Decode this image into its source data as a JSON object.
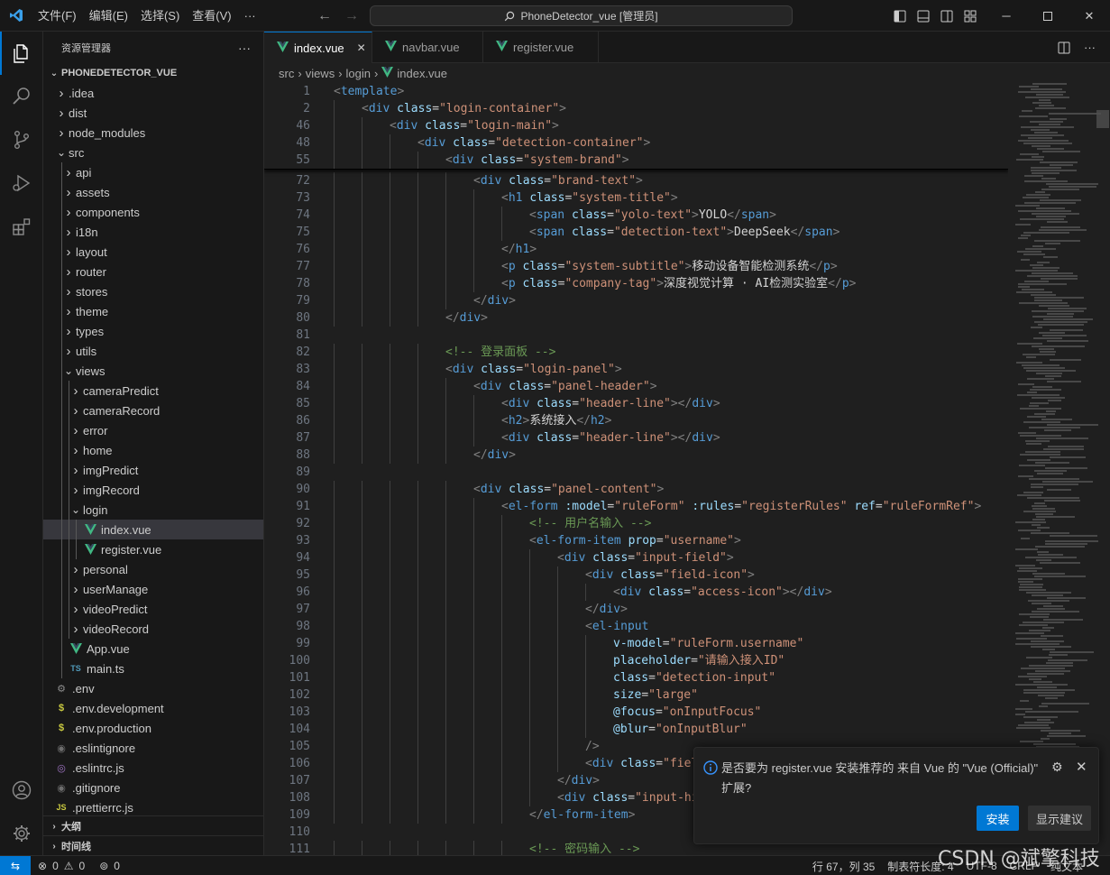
{
  "titlebar": {
    "menu": [
      "文件(F)",
      "编辑(E)",
      "选择(S)",
      "查看(V)",
      "···"
    ],
    "search_text": "PhoneDetector_vue [管理员]"
  },
  "sidebar": {
    "title": "资源管理器",
    "more": "···",
    "root": "PHONEDETECTOR_VUE",
    "items": [
      {
        "label": ".idea",
        "depth": 1,
        "type": "folder",
        "open": false
      },
      {
        "label": "dist",
        "depth": 1,
        "type": "folder",
        "open": false
      },
      {
        "label": "node_modules",
        "depth": 1,
        "type": "folder",
        "open": false
      },
      {
        "label": "src",
        "depth": 1,
        "type": "folder",
        "open": true
      },
      {
        "label": "api",
        "depth": 2,
        "type": "folder",
        "open": false
      },
      {
        "label": "assets",
        "depth": 2,
        "type": "folder",
        "open": false
      },
      {
        "label": "components",
        "depth": 2,
        "type": "folder",
        "open": false
      },
      {
        "label": "i18n",
        "depth": 2,
        "type": "folder",
        "open": false
      },
      {
        "label": "layout",
        "depth": 2,
        "type": "folder",
        "open": false
      },
      {
        "label": "router",
        "depth": 2,
        "type": "folder",
        "open": false
      },
      {
        "label": "stores",
        "depth": 2,
        "type": "folder",
        "open": false
      },
      {
        "label": "theme",
        "depth": 2,
        "type": "folder",
        "open": false
      },
      {
        "label": "types",
        "depth": 2,
        "type": "folder",
        "open": false
      },
      {
        "label": "utils",
        "depth": 2,
        "type": "folder",
        "open": false
      },
      {
        "label": "views",
        "depth": 2,
        "type": "folder",
        "open": true
      },
      {
        "label": "cameraPredict",
        "depth": 3,
        "type": "folder",
        "open": false
      },
      {
        "label": "cameraRecord",
        "depth": 3,
        "type": "folder",
        "open": false
      },
      {
        "label": "error",
        "depth": 3,
        "type": "folder",
        "open": false
      },
      {
        "label": "home",
        "depth": 3,
        "type": "folder",
        "open": false
      },
      {
        "label": "imgPredict",
        "depth": 3,
        "type": "folder",
        "open": false
      },
      {
        "label": "imgRecord",
        "depth": 3,
        "type": "folder",
        "open": false
      },
      {
        "label": "login",
        "depth": 3,
        "type": "folder",
        "open": true
      },
      {
        "label": "index.vue",
        "depth": 4,
        "type": "vue",
        "selected": true
      },
      {
        "label": "register.vue",
        "depth": 4,
        "type": "vue"
      },
      {
        "label": "personal",
        "depth": 3,
        "type": "folder",
        "open": false
      },
      {
        "label": "userManage",
        "depth": 3,
        "type": "folder",
        "open": false
      },
      {
        "label": "videoPredict",
        "depth": 3,
        "type": "folder",
        "open": false
      },
      {
        "label": "videoRecord",
        "depth": 3,
        "type": "folder",
        "open": false
      },
      {
        "label": "App.vue",
        "depth": 2,
        "type": "vue"
      },
      {
        "label": "main.ts",
        "depth": 2,
        "type": "ts"
      },
      {
        "label": ".env",
        "depth": 1,
        "type": "gear"
      },
      {
        "label": ".env.development",
        "depth": 1,
        "type": "dollar"
      },
      {
        "label": ".env.production",
        "depth": 1,
        "type": "dollar"
      },
      {
        "label": ".eslintignore",
        "depth": 1,
        "type": "circle"
      },
      {
        "label": ".eslintrc.js",
        "depth": 1,
        "type": "eslint"
      },
      {
        "label": ".gitignore",
        "depth": 1,
        "type": "circle"
      },
      {
        "label": ".prettierrc.js",
        "depth": 1,
        "type": "js"
      }
    ],
    "outline": "大纲",
    "timeline": "时间线"
  },
  "tabs": [
    {
      "label": "index.vue",
      "active": true,
      "close": "✕"
    },
    {
      "label": "navbar.vue",
      "active": false
    },
    {
      "label": "register.vue",
      "active": false
    }
  ],
  "breadcrumb": [
    "src",
    "views",
    "login",
    "index.vue"
  ],
  "sticky": [
    {
      "n": "1",
      "indent": 0,
      "html": "<span class='c-punc'>&lt;</span><span class='c-tag'>template</span><span class='c-punc'>&gt;</span>"
    },
    {
      "n": "2",
      "indent": 1,
      "html": "<span class='c-punc'>&lt;</span><span class='c-tag'>div</span> <span class='c-attr'>class</span>=<span class='c-str'>\"login-container\"</span><span class='c-punc'>&gt;</span>"
    },
    {
      "n": "46",
      "indent": 2,
      "html": "<span class='c-punc'>&lt;</span><span class='c-tag'>div</span> <span class='c-attr'>class</span>=<span class='c-str'>\"login-main\"</span><span class='c-punc'>&gt;</span>"
    },
    {
      "n": "48",
      "indent": 3,
      "html": "<span class='c-punc'>&lt;</span><span class='c-tag'>div</span> <span class='c-attr'>class</span>=<span class='c-str'>\"detection-container\"</span><span class='c-punc'>&gt;</span>"
    },
    {
      "n": "55",
      "indent": 4,
      "html": "<span class='c-punc'>&lt;</span><span class='c-tag'>div</span> <span class='c-attr'>class</span>=<span class='c-str'>\"system-brand\"</span><span class='c-punc'>&gt;</span>"
    }
  ],
  "code": [
    {
      "n": "72",
      "indent": 5,
      "html": "<span class='c-punc'>&lt;</span><span class='c-tag'>div</span> <span class='c-attr'>class</span>=<span class='c-str'>\"brand-text\"</span><span class='c-punc'>&gt;</span>"
    },
    {
      "n": "73",
      "indent": 6,
      "html": "<span class='c-punc'>&lt;</span><span class='c-tag'>h1</span> <span class='c-attr'>class</span>=<span class='c-str'>\"system-title\"</span><span class='c-punc'>&gt;</span>"
    },
    {
      "n": "74",
      "indent": 7,
      "html": "<span class='c-punc'>&lt;</span><span class='c-tag'>span</span> <span class='c-attr'>class</span>=<span class='c-str'>\"yolo-text\"</span><span class='c-punc'>&gt;</span><span class='c-txt'>YOLO</span><span class='c-punc'>&lt;/</span><span class='c-tag'>span</span><span class='c-punc'>&gt;</span>"
    },
    {
      "n": "75",
      "indent": 7,
      "html": "<span class='c-punc'>&lt;</span><span class='c-tag'>span</span> <span class='c-attr'>class</span>=<span class='c-str'>\"detection-text\"</span><span class='c-punc'>&gt;</span><span class='c-txt'>DeepSeek</span><span class='c-punc'>&lt;/</span><span class='c-tag'>span</span><span class='c-punc'>&gt;</span>"
    },
    {
      "n": "76",
      "indent": 6,
      "html": "<span class='c-punc'>&lt;/</span><span class='c-tag'>h1</span><span class='c-punc'>&gt;</span>"
    },
    {
      "n": "77",
      "indent": 6,
      "html": "<span class='c-punc'>&lt;</span><span class='c-tag'>p</span> <span class='c-attr'>class</span>=<span class='c-str'>\"system-subtitle\"</span><span class='c-punc'>&gt;</span><span class='c-txt'>移动设备智能检测系统</span><span class='c-punc'>&lt;/</span><span class='c-tag'>p</span><span class='c-punc'>&gt;</span>"
    },
    {
      "n": "78",
      "indent": 6,
      "html": "<span class='c-punc'>&lt;</span><span class='c-tag'>p</span> <span class='c-attr'>class</span>=<span class='c-str'>\"company-tag\"</span><span class='c-punc'>&gt;</span><span class='c-txt'>深度视觉计算 · AI检测实验室</span><span class='c-punc'>&lt;/</span><span class='c-tag'>p</span><span class='c-punc'>&gt;</span>"
    },
    {
      "n": "79",
      "indent": 5,
      "html": "<span class='c-punc'>&lt;/</span><span class='c-tag'>div</span><span class='c-punc'>&gt;</span>"
    },
    {
      "n": "80",
      "indent": 4,
      "html": "<span class='c-punc'>&lt;/</span><span class='c-tag'>div</span><span class='c-punc'>&gt;</span>"
    },
    {
      "n": "81",
      "indent": 0,
      "html": ""
    },
    {
      "n": "82",
      "indent": 4,
      "html": "<span class='c-comment'>&lt;!-- 登录面板 --&gt;</span>"
    },
    {
      "n": "83",
      "indent": 4,
      "html": "<span class='c-punc'>&lt;</span><span class='c-tag'>div</span> <span class='c-attr'>class</span>=<span class='c-str'>\"login-panel\"</span><span class='c-punc'>&gt;</span>"
    },
    {
      "n": "84",
      "indent": 5,
      "html": "<span class='c-punc'>&lt;</span><span class='c-tag'>div</span> <span class='c-attr'>class</span>=<span class='c-str'>\"panel-header\"</span><span class='c-punc'>&gt;</span>"
    },
    {
      "n": "85",
      "indent": 6,
      "html": "<span class='c-punc'>&lt;</span><span class='c-tag'>div</span> <span class='c-attr'>class</span>=<span class='c-str'>\"header-line\"</span><span class='c-punc'>&gt;&lt;/</span><span class='c-tag'>div</span><span class='c-punc'>&gt;</span>"
    },
    {
      "n": "86",
      "indent": 6,
      "html": "<span class='c-punc'>&lt;</span><span class='c-tag'>h2</span><span class='c-punc'>&gt;</span><span class='c-txt'>系统接入</span><span class='c-punc'>&lt;/</span><span class='c-tag'>h2</span><span class='c-punc'>&gt;</span>"
    },
    {
      "n": "87",
      "indent": 6,
      "html": "<span class='c-punc'>&lt;</span><span class='c-tag'>div</span> <span class='c-attr'>class</span>=<span class='c-str'>\"header-line\"</span><span class='c-punc'>&gt;&lt;/</span><span class='c-tag'>div</span><span class='c-punc'>&gt;</span>"
    },
    {
      "n": "88",
      "indent": 5,
      "html": "<span class='c-punc'>&lt;/</span><span class='c-tag'>div</span><span class='c-punc'>&gt;</span>"
    },
    {
      "n": "89",
      "indent": 0,
      "html": ""
    },
    {
      "n": "90",
      "indent": 5,
      "html": "<span class='c-punc'>&lt;</span><span class='c-tag'>div</span> <span class='c-attr'>class</span>=<span class='c-str'>\"panel-content\"</span><span class='c-punc'>&gt;</span>"
    },
    {
      "n": "91",
      "indent": 6,
      "html": "<span class='c-punc'>&lt;</span><span class='c-tag'>el-form</span> <span class='c-attr'>:model</span>=<span class='c-str'>\"ruleForm\"</span> <span class='c-attr'>:rules</span>=<span class='c-str'>\"registerRules\"</span> <span class='c-attr'>ref</span>=<span class='c-str'>\"ruleFormRef\"</span><span class='c-punc'>&gt;</span>"
    },
    {
      "n": "92",
      "indent": 7,
      "html": "<span class='c-comment'>&lt;!-- 用户名输入 --&gt;</span>"
    },
    {
      "n": "93",
      "indent": 7,
      "html": "<span class='c-punc'>&lt;</span><span class='c-tag'>el-form-item</span> <span class='c-attr'>prop</span>=<span class='c-str'>\"username\"</span><span class='c-punc'>&gt;</span>"
    },
    {
      "n": "94",
      "indent": 8,
      "html": "<span class='c-punc'>&lt;</span><span class='c-tag'>div</span> <span class='c-attr'>class</span>=<span class='c-str'>\"input-field\"</span><span class='c-punc'>&gt;</span>"
    },
    {
      "n": "95",
      "indent": 9,
      "html": "<span class='c-punc'>&lt;</span><span class='c-tag'>div</span> <span class='c-attr'>class</span>=<span class='c-str'>\"field-icon\"</span><span class='c-punc'>&gt;</span>"
    },
    {
      "n": "96",
      "indent": 10,
      "html": "<span class='c-punc'>&lt;</span><span class='c-tag'>div</span> <span class='c-attr'>class</span>=<span class='c-str'>\"access-icon\"</span><span class='c-punc'>&gt;&lt;/</span><span class='c-tag'>div</span><span class='c-punc'>&gt;</span>"
    },
    {
      "n": "97",
      "indent": 9,
      "html": "<span class='c-punc'>&lt;/</span><span class='c-tag'>div</span><span class='c-punc'>&gt;</span>"
    },
    {
      "n": "98",
      "indent": 9,
      "html": "<span class='c-punc'>&lt;</span><span class='c-tag'>el-input</span>"
    },
    {
      "n": "99",
      "indent": 10,
      "html": "<span class='c-attr'>v-model</span>=<span class='c-str'>\"ruleForm.username\"</span>"
    },
    {
      "n": "100",
      "indent": 10,
      "html": "<span class='c-attr'>placeholder</span>=<span class='c-str'>\"请输入接入ID\"</span>"
    },
    {
      "n": "101",
      "indent": 10,
      "html": "<span class='c-attr'>class</span>=<span class='c-str'>\"detection-input\"</span>"
    },
    {
      "n": "102",
      "indent": 10,
      "html": "<span class='c-attr'>size</span>=<span class='c-str'>\"large\"</span>"
    },
    {
      "n": "103",
      "indent": 10,
      "html": "<span class='c-attr'>@focus</span>=<span class='c-str'>\"onInputFocus\"</span>"
    },
    {
      "n": "104",
      "indent": 10,
      "html": "<span class='c-attr'>@blur</span>=<span class='c-str'>\"onInputBlur\"</span>"
    },
    {
      "n": "105",
      "indent": 9,
      "html": "<span class='c-punc'>/&gt;</span>"
    },
    {
      "n": "106",
      "indent": 9,
      "html": "<span class='c-punc'>&lt;</span><span class='c-tag'>div</span> <span class='c-attr'>class</span>=<span class='c-str'>\"fiel</span>"
    },
    {
      "n": "107",
      "indent": 8,
      "html": "<span class='c-punc'>&lt;/</span><span class='c-tag'>div</span><span class='c-punc'>&gt;</span>"
    },
    {
      "n": "108",
      "indent": 8,
      "html": "<span class='c-punc'>&lt;</span><span class='c-tag'>div</span> <span class='c-attr'>class</span>=<span class='c-str'>\"input-hi</span>"
    },
    {
      "n": "109",
      "indent": 7,
      "html": "<span class='c-punc'>&lt;/</span><span class='c-tag'>el-form-item</span><span class='c-punc'>&gt;</span>"
    },
    {
      "n": "110",
      "indent": 0,
      "html": ""
    },
    {
      "n": "111",
      "indent": 7,
      "html": "<span class='c-comment'>&lt;!-- 密码输入 --&gt;</span>"
    }
  ],
  "notification": {
    "message": "是否要为 register.vue 安装推荐的 来自 Vue 的 \"Vue (Official)\" 扩展?",
    "primary": "安装",
    "secondary": "显示建议"
  },
  "statusbar": {
    "errors": "0",
    "warnings": "0",
    "ports": "0",
    "position": "行 67，列 35",
    "indent": "制表符长度: 4",
    "encoding": "UTF-8",
    "eol": "CRLF",
    "lang": "纯文本"
  },
  "watermark": "CSDN @斌擎科技",
  "colors": {
    "accent": "#0078d4",
    "vue_green": "#41b883"
  }
}
